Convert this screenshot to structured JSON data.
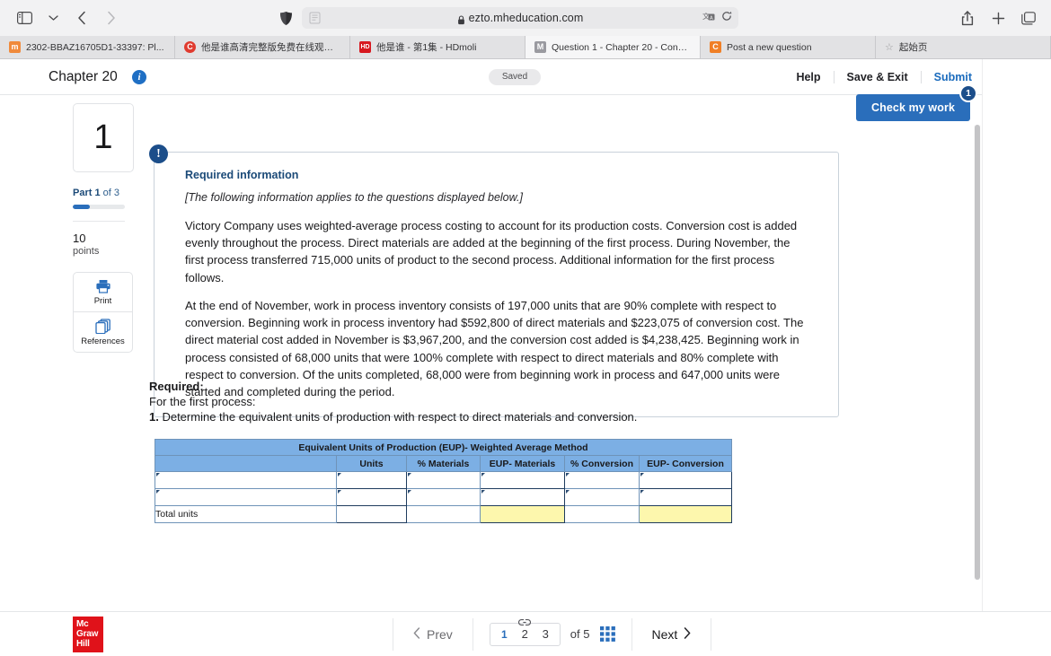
{
  "browser": {
    "url": "ezto.mheducation.com",
    "url_placeholder": "",
    "reader_icon": "reader-icon",
    "lock_icon": "lock-icon",
    "shield_icon": "privacy-shield-icon",
    "translate_icon": "translate-icon",
    "reload_icon": "reload-icon",
    "sidebar_icon": "sidebar-toggle-icon",
    "chevron_icon": "chevron-down-icon",
    "back_icon": "back-arrow-icon",
    "forward_icon": "forward-arrow-icon",
    "share_icon": "share-icon",
    "newtab_icon": "new-tab-icon",
    "tabs_icon": "tab-overview-icon",
    "tabs": [
      {
        "title": "2302-BBAZ16705D1-33397: Pl...",
        "favicon": "m",
        "favicon_color": "#f08a3c",
        "active": false
      },
      {
        "title": "他是谁高清完整版免费在线观看...",
        "favicon": "C",
        "favicon_color": "#e03b2f",
        "active": false
      },
      {
        "title": "他是谁 - 第1集 - HDmoli",
        "favicon": "HD",
        "favicon_color": "#d71920",
        "active": false
      },
      {
        "title": "Question 1 - Chapter 20 - Conn...",
        "favicon": "M",
        "favicon_color": "#9a9aa0",
        "active": true
      },
      {
        "title": "Post a new question",
        "favicon": "C",
        "favicon_color": "#f07f26",
        "active": false
      },
      {
        "title": "起始页",
        "favicon": "star",
        "favicon_color": "#9a9a9d",
        "active": false
      }
    ]
  },
  "header": {
    "chapter_title": "Chapter 20",
    "info_icon": "info-icon",
    "saved_label": "Saved",
    "help_label": "Help",
    "save_exit_label": "Save & Exit",
    "submit_label": "Submit"
  },
  "check_work": {
    "label": "Check my work",
    "badge": "1",
    "accent": "#2a6ebb"
  },
  "sidebar": {
    "question_number": "1",
    "part_prefix": "Part 1",
    "part_suffix": "of 3",
    "progress_percent": 33,
    "points_value": "10",
    "points_label": "points",
    "tools": [
      {
        "label": "Print",
        "icon": "printer-icon"
      },
      {
        "label": "References",
        "icon": "references-icon"
      }
    ]
  },
  "required_info": {
    "alert_icon": "exclamation-icon",
    "heading": "Required information",
    "applies_note": "[The following information applies to the questions displayed below.]",
    "paragraphs": [
      "Victory Company uses weighted-average process costing to account for its production costs. Conversion cost is added evenly throughout the process. Direct materials are added at the beginning of the first process. During November, the first process transferred 715,000 units of product to the second process. Additional information for the first process follows.",
      "At the end of November, work in process inventory consists of 197,000 units that are 90% complete with respect to conversion. Beginning work in process inventory had $592,800 of direct materials and $223,075 of conversion cost. The direct material cost added in November is $3,967,200, and the conversion cost added is $4,238,425. Beginning work in process consisted of 68,000 units that were 100% complete with respect to direct materials and 80% complete with respect to conversion. Of the units completed, 68,000 were from beginning work in process and 647,000 units were started and completed during the period."
    ]
  },
  "required_section": {
    "title": "Required:",
    "subtitle": "For the first process:",
    "item_number": "1.",
    "item_text": " Determine the equivalent units of production with respect to direct materials and conversion."
  },
  "eup_table": {
    "title": "Equivalent Units of Production (EUP)- Weighted Average Method",
    "columns": [
      "",
      "Units",
      "% Materials",
      "EUP- Materials",
      "% Conversion",
      "EUP- Conversion"
    ],
    "rows": [
      {
        "label": "",
        "units": "",
        "pct_materials": "",
        "eup_materials": "",
        "pct_conversion": "",
        "eup_conversion": ""
      },
      {
        "label": "",
        "units": "",
        "pct_materials": "",
        "eup_materials": "",
        "pct_conversion": "",
        "eup_conversion": ""
      }
    ],
    "total_row": {
      "label": "Total units",
      "units": "",
      "pct_materials": "",
      "eup_materials": "",
      "pct_conversion": "",
      "eup_conversion": ""
    },
    "header_color": "#7cafe4",
    "highlight_color": "#fdf7ad"
  },
  "footer": {
    "logo_line1": "Mc",
    "logo_line2": "Graw",
    "logo_line3": "Hill",
    "logo_color": "#e0121a",
    "prev_label": "Prev",
    "next_label": "Next",
    "page_numbers": [
      "1",
      "2",
      "3"
    ],
    "current_page": "1",
    "of_label": "of",
    "total_pages": "5",
    "link_icon": "chain-link-icon",
    "grid_icon": "grid-view-icon"
  }
}
